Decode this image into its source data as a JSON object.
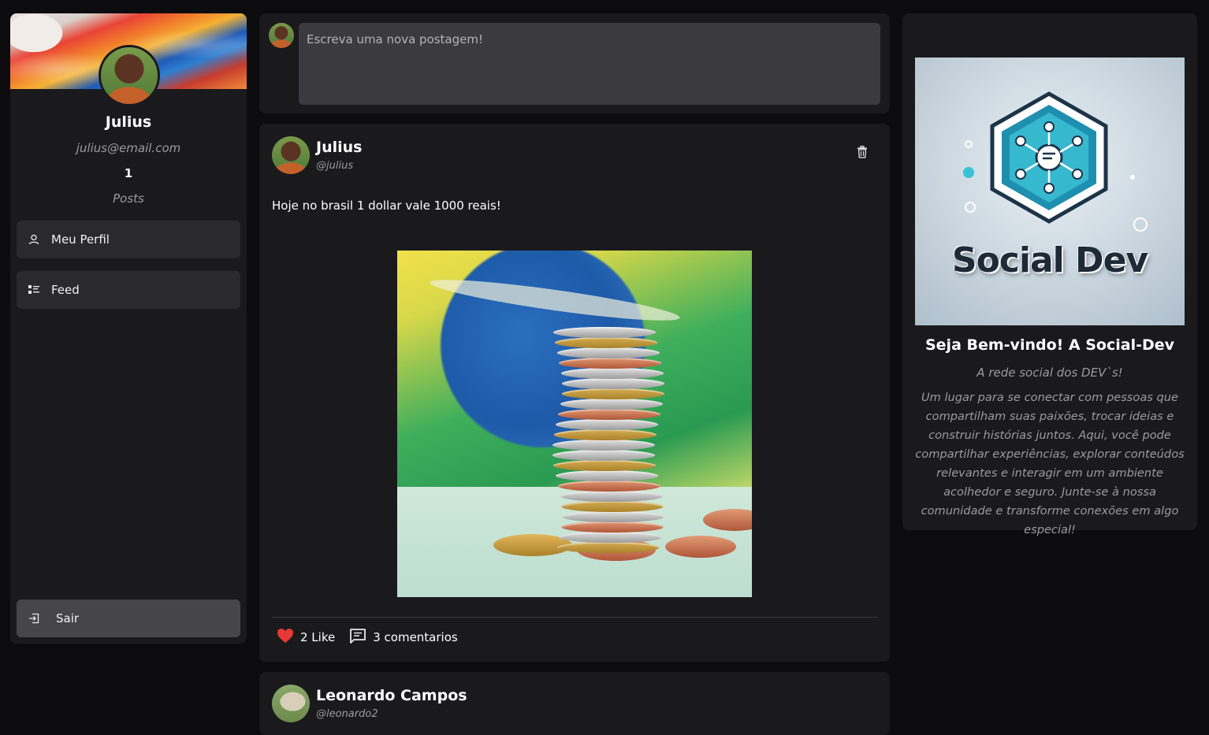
{
  "profile": {
    "name": "Julius",
    "email": "julius@email.com",
    "post_count": "1",
    "posts_label": "Posts"
  },
  "nav": {
    "profile_label": "Meu Perfil",
    "feed_label": "Feed",
    "exit_label": "Sair"
  },
  "composer": {
    "placeholder": "Escreva uma nova postagem!"
  },
  "posts": [
    {
      "author": "Julius",
      "handle": "@julius",
      "text": "Hoje no brasil 1 dollar vale 1000 reais!",
      "likes_label": "2 Like",
      "comments_label": "3 comentarios"
    },
    {
      "author": "Leonardo Campos",
      "handle": "@leonardo2"
    }
  ],
  "welcome": {
    "logo_text": "Social Dev",
    "title": "Seja Bem-vindo! A Social-Dev",
    "subtitle": "A rede social dos DEV`s!",
    "description": "Um lugar para se conectar com pessoas que compartilham suas paixões, trocar ideias e construir histórias juntos. Aqui, você pode compartilhar experiências, explorar conteúdos relevantes e interagir em um ambiente acolhedor e seguro. Junte-se à nossa comunidade e transforme conexões em algo especial!"
  },
  "colors": {
    "background": "#0c0c0e",
    "panel": "#1a1a1d",
    "button": "#2a2a2e",
    "button_active": "#45454a",
    "like": "#e53935"
  },
  "icons": {
    "profile": "user-icon",
    "feed": "list-icon",
    "exit": "logout-icon",
    "delete": "trash-icon",
    "like": "heart-icon",
    "comments": "comment-icon"
  }
}
